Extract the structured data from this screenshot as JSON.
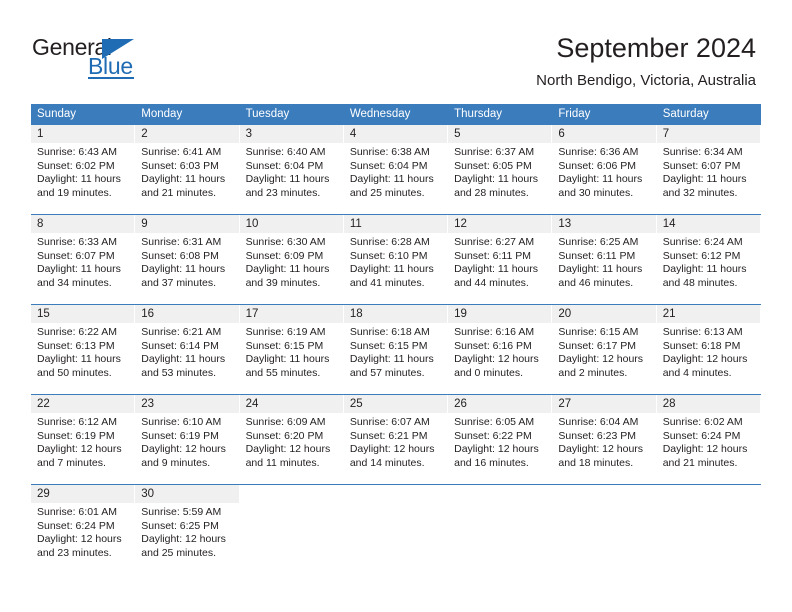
{
  "brand": {
    "name_top": "General",
    "name_bottom": "Blue",
    "accent_color": "#1f6cb4"
  },
  "header": {
    "title": "September 2024",
    "location": "North Bendigo, Victoria, Australia"
  },
  "calendar": {
    "header_color": "#3b7cbc",
    "daynum_band_color": "#f0f0f0",
    "weekdays": [
      "Sunday",
      "Monday",
      "Tuesday",
      "Wednesday",
      "Thursday",
      "Friday",
      "Saturday"
    ],
    "weeks": [
      [
        {
          "day": "1",
          "sunrise": "Sunrise: 6:43 AM",
          "sunset": "Sunset: 6:02 PM",
          "daylight": "Daylight: 11 hours and 19 minutes."
        },
        {
          "day": "2",
          "sunrise": "Sunrise: 6:41 AM",
          "sunset": "Sunset: 6:03 PM",
          "daylight": "Daylight: 11 hours and 21 minutes."
        },
        {
          "day": "3",
          "sunrise": "Sunrise: 6:40 AM",
          "sunset": "Sunset: 6:04 PM",
          "daylight": "Daylight: 11 hours and 23 minutes."
        },
        {
          "day": "4",
          "sunrise": "Sunrise: 6:38 AM",
          "sunset": "Sunset: 6:04 PM",
          "daylight": "Daylight: 11 hours and 25 minutes."
        },
        {
          "day": "5",
          "sunrise": "Sunrise: 6:37 AM",
          "sunset": "Sunset: 6:05 PM",
          "daylight": "Daylight: 11 hours and 28 minutes."
        },
        {
          "day": "6",
          "sunrise": "Sunrise: 6:36 AM",
          "sunset": "Sunset: 6:06 PM",
          "daylight": "Daylight: 11 hours and 30 minutes."
        },
        {
          "day": "7",
          "sunrise": "Sunrise: 6:34 AM",
          "sunset": "Sunset: 6:07 PM",
          "daylight": "Daylight: 11 hours and 32 minutes."
        }
      ],
      [
        {
          "day": "8",
          "sunrise": "Sunrise: 6:33 AM",
          "sunset": "Sunset: 6:07 PM",
          "daylight": "Daylight: 11 hours and 34 minutes."
        },
        {
          "day": "9",
          "sunrise": "Sunrise: 6:31 AM",
          "sunset": "Sunset: 6:08 PM",
          "daylight": "Daylight: 11 hours and 37 minutes."
        },
        {
          "day": "10",
          "sunrise": "Sunrise: 6:30 AM",
          "sunset": "Sunset: 6:09 PM",
          "daylight": "Daylight: 11 hours and 39 minutes."
        },
        {
          "day": "11",
          "sunrise": "Sunrise: 6:28 AM",
          "sunset": "Sunset: 6:10 PM",
          "daylight": "Daylight: 11 hours and 41 minutes."
        },
        {
          "day": "12",
          "sunrise": "Sunrise: 6:27 AM",
          "sunset": "Sunset: 6:11 PM",
          "daylight": "Daylight: 11 hours and 44 minutes."
        },
        {
          "day": "13",
          "sunrise": "Sunrise: 6:25 AM",
          "sunset": "Sunset: 6:11 PM",
          "daylight": "Daylight: 11 hours and 46 minutes."
        },
        {
          "day": "14",
          "sunrise": "Sunrise: 6:24 AM",
          "sunset": "Sunset: 6:12 PM",
          "daylight": "Daylight: 11 hours and 48 minutes."
        }
      ],
      [
        {
          "day": "15",
          "sunrise": "Sunrise: 6:22 AM",
          "sunset": "Sunset: 6:13 PM",
          "daylight": "Daylight: 11 hours and 50 minutes."
        },
        {
          "day": "16",
          "sunrise": "Sunrise: 6:21 AM",
          "sunset": "Sunset: 6:14 PM",
          "daylight": "Daylight: 11 hours and 53 minutes."
        },
        {
          "day": "17",
          "sunrise": "Sunrise: 6:19 AM",
          "sunset": "Sunset: 6:15 PM",
          "daylight": "Daylight: 11 hours and 55 minutes."
        },
        {
          "day": "18",
          "sunrise": "Sunrise: 6:18 AM",
          "sunset": "Sunset: 6:15 PM",
          "daylight": "Daylight: 11 hours and 57 minutes."
        },
        {
          "day": "19",
          "sunrise": "Sunrise: 6:16 AM",
          "sunset": "Sunset: 6:16 PM",
          "daylight": "Daylight: 12 hours and 0 minutes."
        },
        {
          "day": "20",
          "sunrise": "Sunrise: 6:15 AM",
          "sunset": "Sunset: 6:17 PM",
          "daylight": "Daylight: 12 hours and 2 minutes."
        },
        {
          "day": "21",
          "sunrise": "Sunrise: 6:13 AM",
          "sunset": "Sunset: 6:18 PM",
          "daylight": "Daylight: 12 hours and 4 minutes."
        }
      ],
      [
        {
          "day": "22",
          "sunrise": "Sunrise: 6:12 AM",
          "sunset": "Sunset: 6:19 PM",
          "daylight": "Daylight: 12 hours and 7 minutes."
        },
        {
          "day": "23",
          "sunrise": "Sunrise: 6:10 AM",
          "sunset": "Sunset: 6:19 PM",
          "daylight": "Daylight: 12 hours and 9 minutes."
        },
        {
          "day": "24",
          "sunrise": "Sunrise: 6:09 AM",
          "sunset": "Sunset: 6:20 PM",
          "daylight": "Daylight: 12 hours and 11 minutes."
        },
        {
          "day": "25",
          "sunrise": "Sunrise: 6:07 AM",
          "sunset": "Sunset: 6:21 PM",
          "daylight": "Daylight: 12 hours and 14 minutes."
        },
        {
          "day": "26",
          "sunrise": "Sunrise: 6:05 AM",
          "sunset": "Sunset: 6:22 PM",
          "daylight": "Daylight: 12 hours and 16 minutes."
        },
        {
          "day": "27",
          "sunrise": "Sunrise: 6:04 AM",
          "sunset": "Sunset: 6:23 PM",
          "daylight": "Daylight: 12 hours and 18 minutes."
        },
        {
          "day": "28",
          "sunrise": "Sunrise: 6:02 AM",
          "sunset": "Sunset: 6:24 PM",
          "daylight": "Daylight: 12 hours and 21 minutes."
        }
      ],
      [
        {
          "day": "29",
          "sunrise": "Sunrise: 6:01 AM",
          "sunset": "Sunset: 6:24 PM",
          "daylight": "Daylight: 12 hours and 23 minutes."
        },
        {
          "day": "30",
          "sunrise": "Sunrise: 5:59 AM",
          "sunset": "Sunset: 6:25 PM",
          "daylight": "Daylight: 12 hours and 25 minutes."
        },
        {
          "day": "",
          "sunrise": "",
          "sunset": "",
          "daylight": ""
        },
        {
          "day": "",
          "sunrise": "",
          "sunset": "",
          "daylight": ""
        },
        {
          "day": "",
          "sunrise": "",
          "sunset": "",
          "daylight": ""
        },
        {
          "day": "",
          "sunrise": "",
          "sunset": "",
          "daylight": ""
        },
        {
          "day": "",
          "sunrise": "",
          "sunset": "",
          "daylight": ""
        }
      ]
    ]
  }
}
